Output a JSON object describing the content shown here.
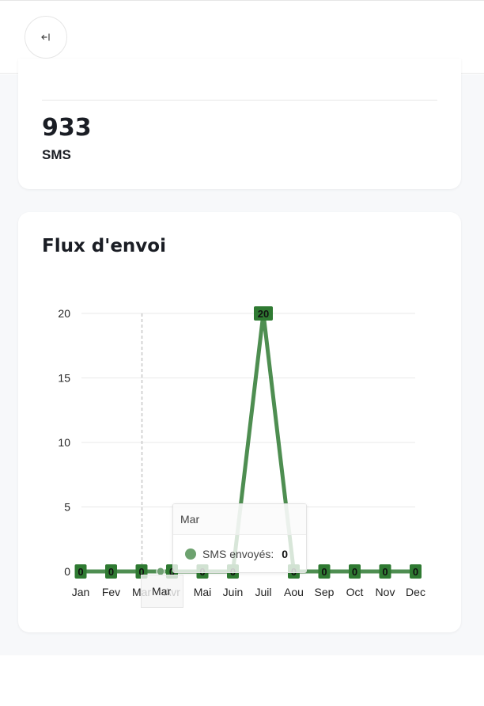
{
  "header": {
    "back_icon": "back-arrow-icon"
  },
  "stats": {
    "value": "933",
    "unit": "SMS"
  },
  "chart_card": {
    "title": "Flux d'envoi"
  },
  "chart_data": {
    "type": "line",
    "categories": [
      "Jan",
      "Fev",
      "Mar",
      "Avr",
      "Mai",
      "Juin",
      "Juil",
      "Aou",
      "Sep",
      "Oct",
      "Nov",
      "Dec"
    ],
    "series": [
      {
        "name": "SMS envoyés",
        "values": [
          0,
          0,
          0,
          0,
          0,
          0,
          20,
          0,
          0,
          0,
          0,
          0
        ],
        "color": "#2f7a32"
      }
    ],
    "ylim": [
      0,
      20
    ],
    "yticks": [
      0,
      5,
      10,
      15,
      20
    ],
    "data_labels": true,
    "grid": true,
    "tooltip": {
      "category": "Mar",
      "label": "SMS envoyés:",
      "value": "0"
    },
    "crosshair_label": "Mar"
  },
  "colors": {
    "accent": "#2f7a32",
    "background": "#f7f8fa",
    "card": "#ffffff"
  }
}
